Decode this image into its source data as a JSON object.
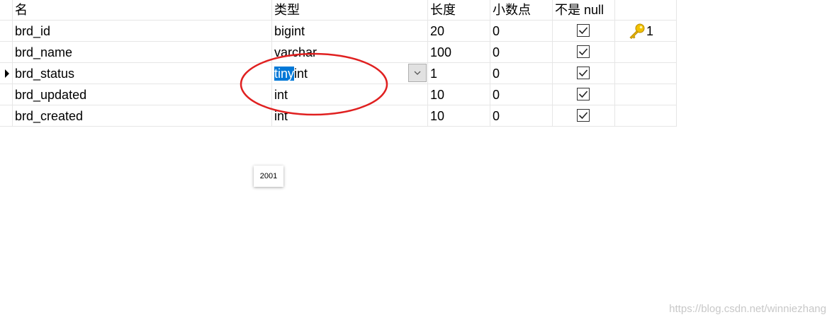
{
  "columns": {
    "name": "名",
    "type": "类型",
    "length": "长度",
    "decimal": "小数点",
    "not_null": "不是 null"
  },
  "rows": [
    {
      "name": "brd_id",
      "type": "bigint",
      "length": "20",
      "decimal": "0",
      "not_null": true,
      "key": "1"
    },
    {
      "name": "brd_name",
      "type": "varchar",
      "length": "100",
      "decimal": "0",
      "not_null": true
    },
    {
      "name": "brd_status",
      "type_selected": "tiny",
      "type_rest": "int",
      "length": "1",
      "decimal": "0",
      "not_null": true
    },
    {
      "name": "brd_updated",
      "type": "int",
      "length": "10",
      "decimal": "0",
      "not_null": true
    },
    {
      "name": "brd_created",
      "type": "int",
      "length": "10",
      "decimal": "0",
      "not_null": true
    }
  ],
  "tooltip": "2001",
  "watermark": "https://blog.csdn.net/winniezhang",
  "icons": {
    "current_row": "row-pointer-icon",
    "primary_key": "key-icon",
    "dropdown": "chevron-down-icon",
    "checkbox": "checkmark-icon"
  },
  "colors": {
    "selection": "#0078d7",
    "annotation": "#e02020",
    "key": "#e8b300"
  }
}
